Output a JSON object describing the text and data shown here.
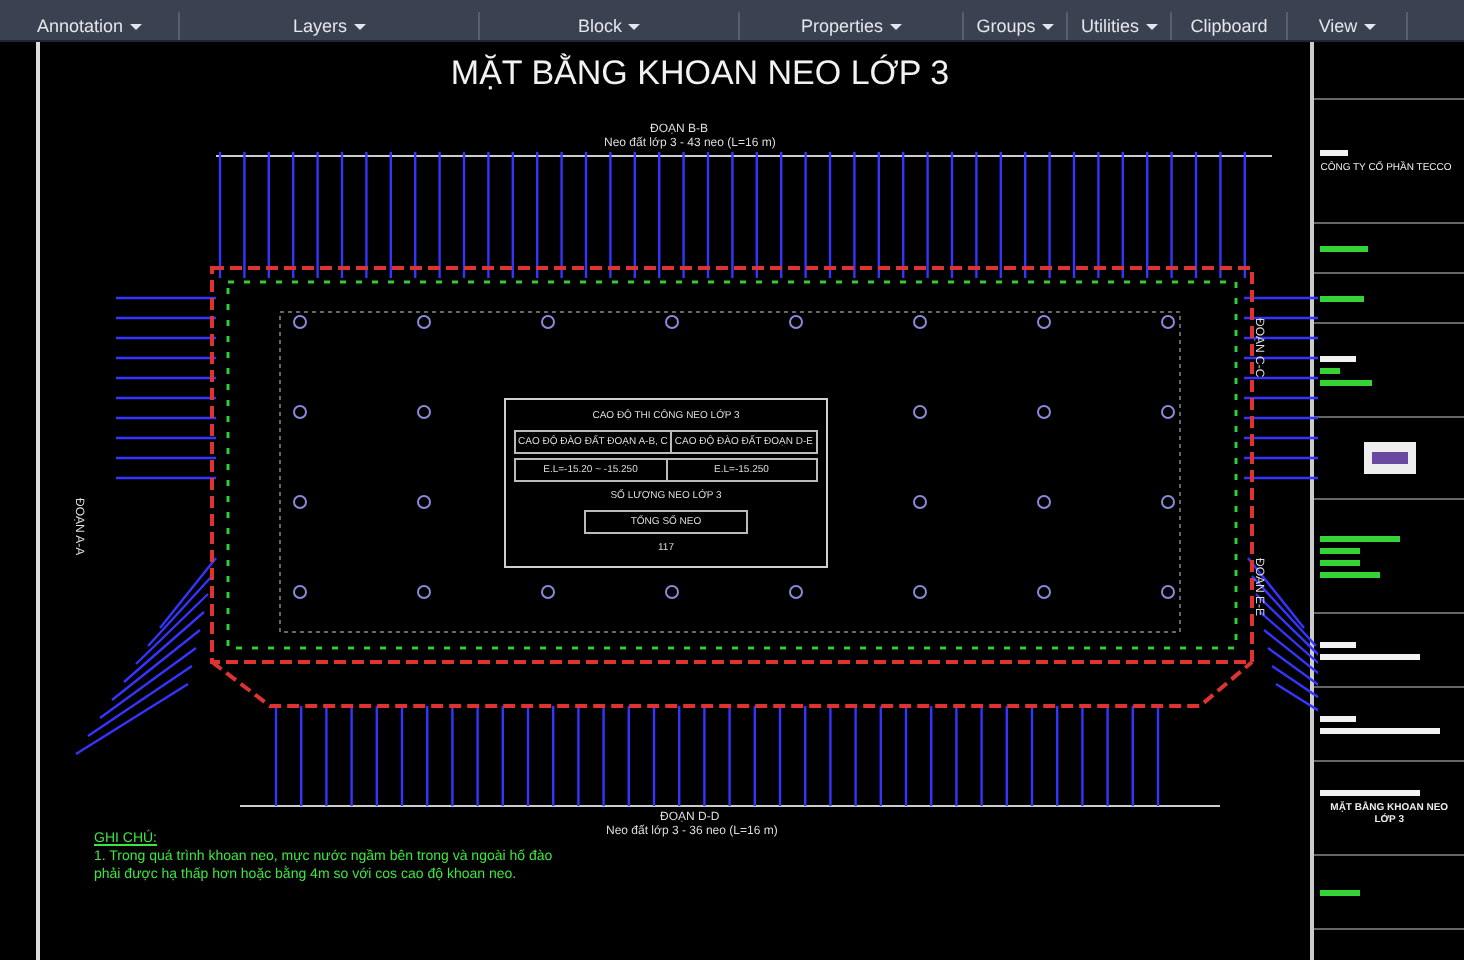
{
  "ribbon": {
    "panels": [
      {
        "label": "Annotation",
        "menu": true
      },
      {
        "label": "Layers",
        "menu": true
      },
      {
        "label": "Block",
        "menu": true
      },
      {
        "label": "Properties",
        "menu": true
      },
      {
        "label": "Groups",
        "menu": true
      },
      {
        "label": "Utilities",
        "menu": true
      },
      {
        "label": "Clipboard",
        "menu": false
      },
      {
        "label": "View",
        "menu": true
      }
    ]
  },
  "plan": {
    "title": "MẶT BẰNG KHOAN NEO LỚP 3",
    "top": {
      "label": "ĐOẠN B-B",
      "note": "Neo đất lớp 3 - 43 neo (L=16 m)"
    },
    "bottom": {
      "label": "ĐOẠN D-D",
      "note": "Neo đất lớp 3 - 36 neo (L=16 m)"
    },
    "left_label": "ĐOẠN A-A",
    "right_labels": [
      "ĐOẠN C-C",
      "ĐOẠN E-E"
    ],
    "table": {
      "heading": "CAO ĐỘ THI CÔNG NEO LỚP 3",
      "columns": [
        "CAO ĐỘ ĐÀO ĐẤT ĐOẠN A-B, C",
        "CAO ĐỘ ĐÀO ĐẤT ĐOẠN D-E"
      ],
      "values": [
        "E.L=-15.20 ~ -15.250",
        "E.L=-15.250"
      ],
      "count_heading": "SỐ LƯỢNG NEO LỚP 3",
      "total_label": "TỔNG SỐ NEO",
      "total": "117"
    },
    "notes": {
      "heading": "GHI CHÚ:",
      "items": [
        "1. Trong quá trình khoan neo, mực nước ngầm bên trong và ngoài hố đào phải được hạ thấp hơn hoặc bằng 4m so với cos cao độ khoan neo."
      ]
    }
  },
  "title_block": {
    "company": "CÔNG TY CỔ PHẦN TECCO",
    "drawing_title": "MẶT BẰNG KHOAN NEO LỚP 3"
  }
}
